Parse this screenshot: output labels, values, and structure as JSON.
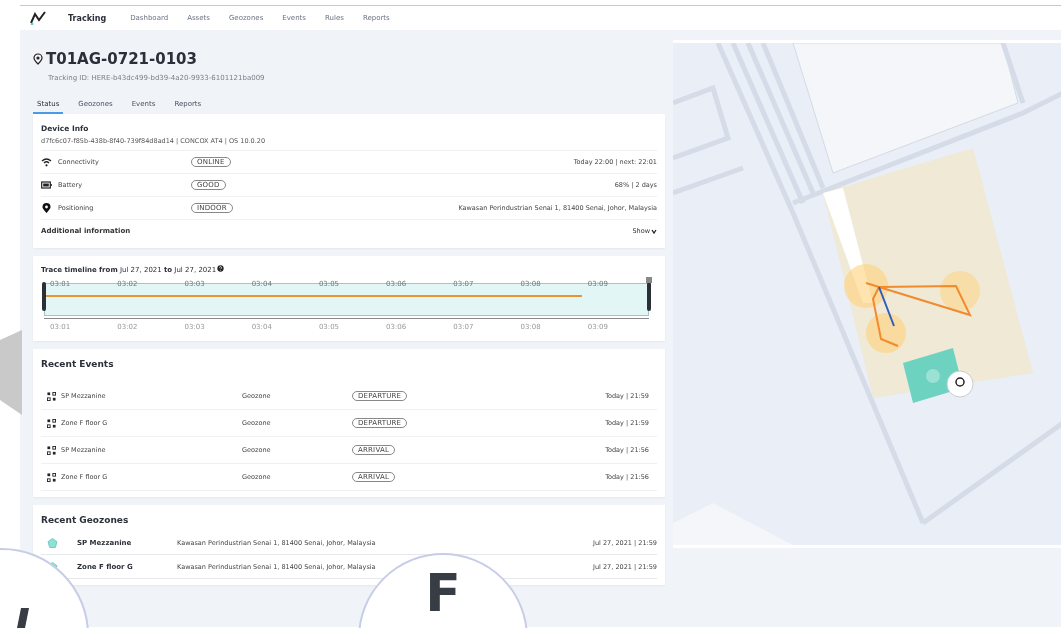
{
  "nav": {
    "brand": "Tracking",
    "items": [
      {
        "label": "Dashboard",
        "selected": false
      },
      {
        "label": "Assets",
        "selected": false
      },
      {
        "label": "Geozones",
        "selected": false
      },
      {
        "label": "Events",
        "selected": false
      },
      {
        "label": "Rules",
        "selected": false
      },
      {
        "label": "Reports",
        "selected": false
      }
    ]
  },
  "asset": {
    "title": "T01AG-0721-0103",
    "tracking_id": "Tracking ID: HERE-b43dc499-bd39-4a20-9933-6101121ba009"
  },
  "tabs": [
    {
      "label": "Status",
      "selected": true
    },
    {
      "label": "Geozones",
      "selected": false
    },
    {
      "label": "Events",
      "selected": false
    },
    {
      "label": "Reports",
      "selected": false
    }
  ],
  "device_info": {
    "title": "Device Info",
    "details": "d7fc6c07-f85b-438b-8f40-739f84d8ad14 | CONCOX AT4 | OS 10.0.20",
    "rows": [
      {
        "kind": "connectivity",
        "label": "Connectivity",
        "status": "ONLINE",
        "value": "Today 22:00 | next: 22:01"
      },
      {
        "kind": "battery",
        "label": "Battery",
        "status": "GOOD",
        "value": "68% | 2 days"
      },
      {
        "kind": "positioning",
        "label": "Positioning",
        "status": "INDOOR",
        "value": "Kawasan Perindustrian Senai 1, 81400 Senai, Johor, Malaysia"
      }
    ],
    "additional": {
      "label": "Additional information",
      "toggle": "Show",
      "expanded": false
    }
  },
  "timeline": {
    "title": "**Trace timeline**  **from** Jul 27, 2021 **to** Jul 27, 2021",
    "level": 0.89,
    "ticks_top": [
      "03:01",
      "03:02",
      "03:03",
      "03:04",
      "03:05",
      "03:06",
      "03:07",
      "03:08",
      "03:09"
    ],
    "ticks_bottom": [
      "03:01",
      "03:02",
      "03:03",
      "03:04",
      "03:05",
      "03:06",
      "03:07",
      "03:08",
      "03:09"
    ]
  },
  "recent_events": {
    "title": "Recent Events",
    "rows": [
      {
        "name": "SP Mezzanine",
        "type": "Geozone",
        "event": "DEPARTURE",
        "time": "Today | 21:59"
      },
      {
        "name": "Zone F floor G",
        "type": "Geozone",
        "event": "DEPARTURE",
        "time": "Today | 21:59"
      },
      {
        "name": "SP Mezzanine",
        "type": "Geozone",
        "event": "ARRIVAL",
        "time": "Today | 21:56"
      },
      {
        "name": "Zone F floor G",
        "type": "Geozone",
        "event": "ARRIVAL",
        "time": "Today | 21:56"
      }
    ]
  },
  "recent_geozones": {
    "title": "Recent Geozones",
    "rows": [
      {
        "name": "SP Mezzanine",
        "address": "Kawasan Perindustrian Senai 1, 81400 Senai, Johor, Malaysia",
        "time": "Jul 27, 2021 | 21:59"
      },
      {
        "name": "Zone F floor G",
        "address": "Kawasan Perindustrian Senai 1, 81400 Senai, Johor, Malaysia",
        "time": "Jul 27, 2021 | 21:59"
      }
    ]
  },
  "overlay": {
    "letter": "F"
  }
}
